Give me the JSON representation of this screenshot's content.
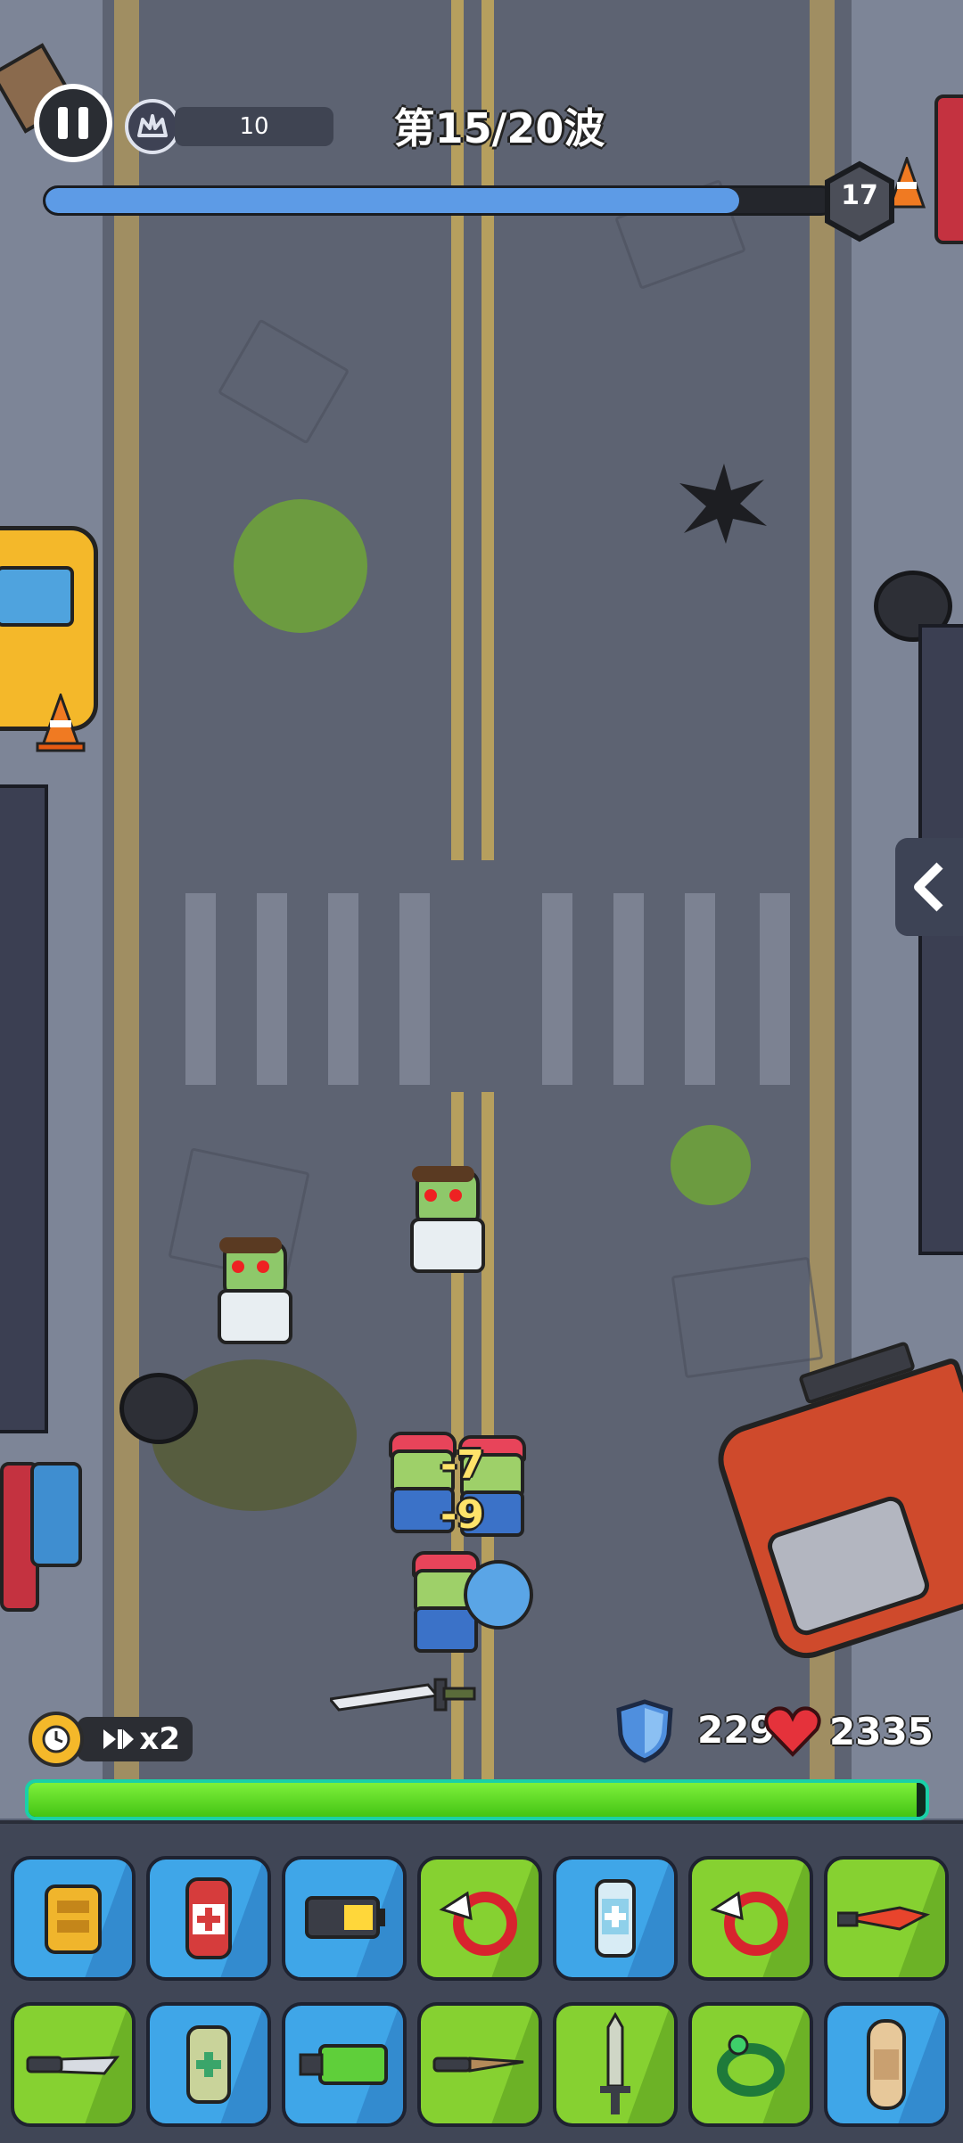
{
  "hud": {
    "score": "10",
    "wave_label": "第15/20波",
    "wave_progress": 0.88,
    "wave_badge": "17"
  },
  "combat": {
    "speed_label": "x2",
    "shield_value": "229",
    "hp_value": "2335",
    "hp_fraction": 0.99,
    "damage_numbers": [
      "-7",
      "-9"
    ]
  },
  "inventory": {
    "row1": [
      {
        "icon": "armor-vest-icon",
        "rarity": "blue"
      },
      {
        "icon": "medkit-canister-icon",
        "rarity": "blue"
      },
      {
        "icon": "battery-icon",
        "rarity": "blue"
      },
      {
        "icon": "winged-ring-icon",
        "rarity": "green"
      },
      {
        "icon": "medicine-vial-icon",
        "rarity": "blue"
      },
      {
        "icon": "winged-ring-icon",
        "rarity": "green"
      },
      {
        "icon": "flame-knife-icon",
        "rarity": "green"
      }
    ],
    "row2": [
      {
        "icon": "combat-knife-icon",
        "rarity": "green"
      },
      {
        "icon": "bandage-roll-icon",
        "rarity": "blue"
      },
      {
        "icon": "energy-cell-icon",
        "rarity": "blue"
      },
      {
        "icon": "dagger-icon",
        "rarity": "green"
      },
      {
        "icon": "sword-icon",
        "rarity": "green"
      },
      {
        "icon": "green-ring-icon",
        "rarity": "green"
      },
      {
        "icon": "bandage-patch-icon",
        "rarity": "blue"
      }
    ]
  },
  "colors": {
    "wave_fill": "#5d9be6",
    "hp_fill": "#5ed622",
    "slot_blue": "#3fa6e8",
    "slot_green": "#86d131"
  }
}
